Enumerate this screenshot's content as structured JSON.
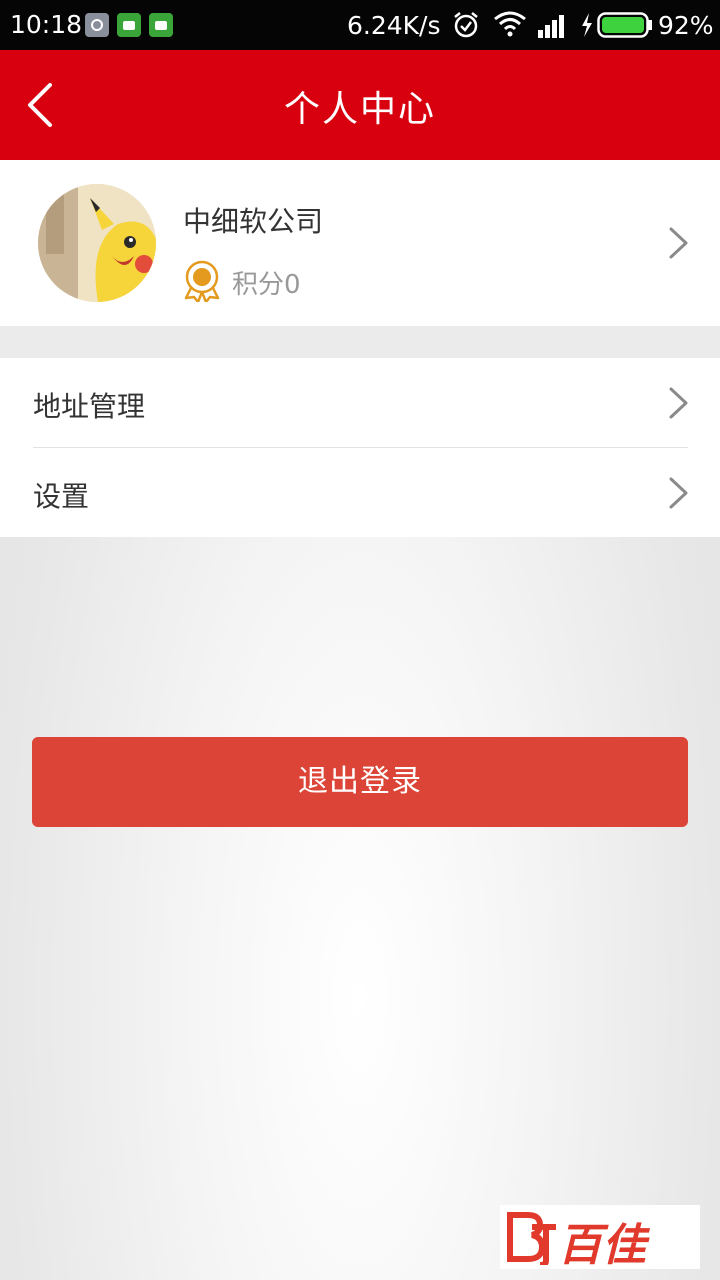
{
  "status_bar": {
    "time": "10:18",
    "net_speed": "6.24K/s",
    "battery": "92%"
  },
  "header": {
    "title": "个人中心"
  },
  "profile": {
    "name": "中细软公司",
    "points": "积分0"
  },
  "menu": {
    "items": [
      {
        "label": "地址管理"
      },
      {
        "label": "设置"
      }
    ]
  },
  "logout_label": "退出登录",
  "watermark": {
    "text": "百佳"
  },
  "colors": {
    "header": "#d8000f",
    "logout": "#dc4437",
    "medal": "#e39a1e"
  }
}
